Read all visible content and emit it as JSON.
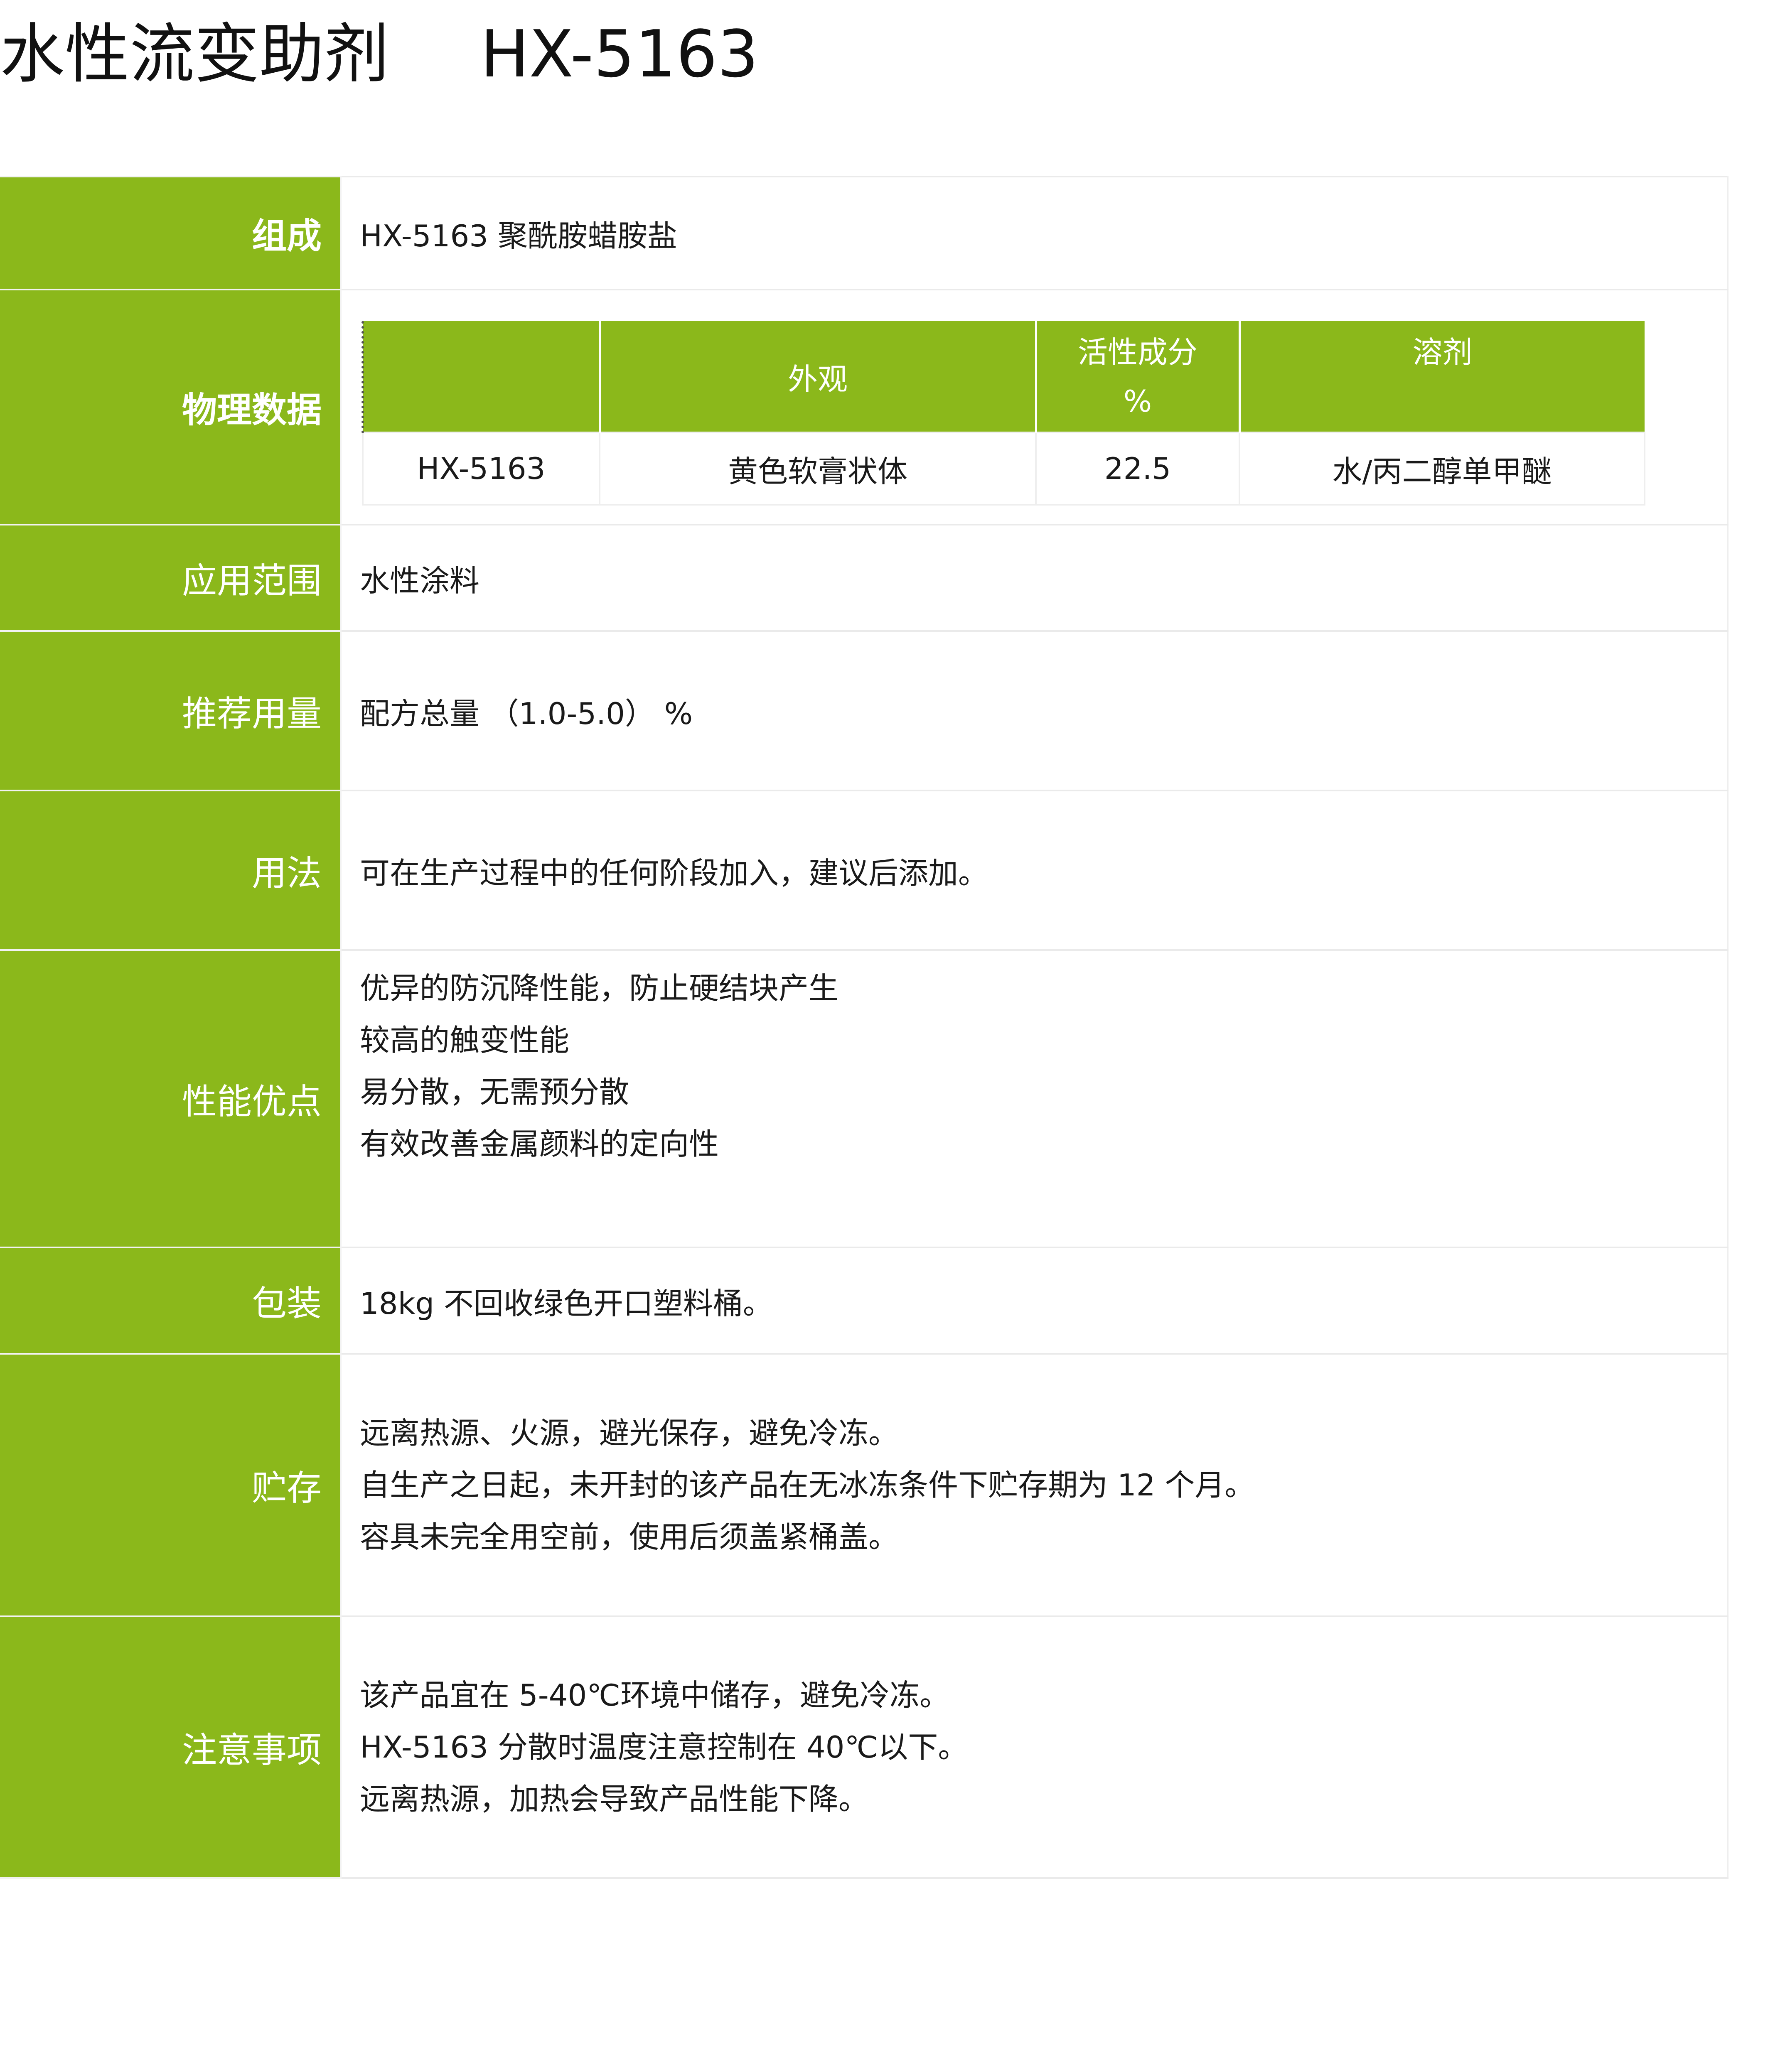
{
  "title": {
    "name": "水性流变助剂",
    "code": "HX-5163"
  },
  "rows": {
    "composition": {
      "label": "组成",
      "value": "HX-5163 聚酰胺蜡胺盐"
    },
    "physical": {
      "label": "物理数据",
      "headers": [
        "",
        "外观",
        "活性成分",
        "%",
        "溶剂"
      ],
      "data": [
        "HX-5163",
        "黄色软膏状体",
        "22.5",
        "水/丙二醇单甲醚"
      ]
    },
    "application": {
      "label": "应用范围",
      "value": "水性涂料"
    },
    "dosage": {
      "label": "推荐用量",
      "value": "配方总量 （1.0-5.0） %"
    },
    "usage": {
      "label": "用法",
      "value": "可在生产过程中的任何阶段加入，建议后添加。"
    },
    "advantages": {
      "label": "性能优点",
      "lines": [
        "优异的防沉降性能，防止硬结块产生",
        "较高的触变性能",
        "易分散，无需预分散",
        "有效改善金属颜料的定向性"
      ]
    },
    "packaging": {
      "label": "包装",
      "value": "18kg  不回收绿色开口塑料桶。"
    },
    "storage": {
      "label": "贮存",
      "lines": [
        "远离热源、火源，避光保存，避免冷冻。",
        "自生产之日起，未开封的该产品在无冰冻条件下贮存期为  12  个月。",
        "容具未完全用空前，使用后须盖紧桶盖。"
      ]
    },
    "notes": {
      "label": "注意事项",
      "lines": [
        "该产品宜在  5-40℃环境中储存，避免冷冻。",
        "HX-5163  分散时温度注意控制在  40℃以下。",
        "远离热源，加热会导致产品性能下降。"
      ]
    }
  },
  "colors": {
    "label_bg": "#8bb81b",
    "label_text": "#ffffff",
    "border": "#eaeaea"
  }
}
